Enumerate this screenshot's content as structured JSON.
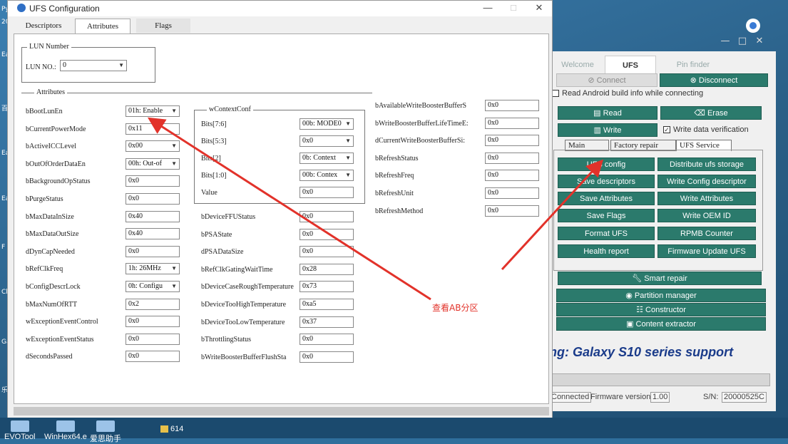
{
  "desktop": {
    "left_icons": [
      "Py",
      "20",
      "Ea",
      "百",
      "Ea",
      "Ea",
      "F",
      "Cl",
      "Ga",
      "乐"
    ]
  },
  "taskbar": {
    "items": [
      "EVOTool",
      "WinHex64.e",
      "爱思助手"
    ],
    "folder": "614"
  },
  "right_app": {
    "tabs": [
      "Welcome",
      "UFS",
      "Pin finder"
    ],
    "connect": "Connect",
    "disconnect": "Disconnect",
    "read_android_info": "Read Android build info while connecting",
    "read": "Read",
    "erase": "Erase",
    "write": "Write",
    "write_verify": "Write data verification",
    "subtabs": [
      "Main",
      "Factory repair",
      "UFS Service"
    ],
    "service_buttons": [
      "UFS config",
      "Distribute ufs storage",
      "Save descriptors",
      "Write Config descriptor",
      "Save Attributes",
      "Write Attributes",
      "Save Flags",
      "Write OEM ID",
      "Format UFS",
      "RPMB Counter",
      "Health report",
      "Firmware Update UFS"
    ],
    "smart_repair": "Smart repair",
    "partition_manager": "Partition manager",
    "constructor": "Constructor",
    "content_extractor": "Content extractor",
    "marquee": "ng: Galaxy S10 series support",
    "status": {
      "connected": "Connected",
      "fw_label": "Firmware version:",
      "fw_value": "1.00",
      "sn_label": "S/N:",
      "sn_value": "20000525C"
    }
  },
  "ufs_window": {
    "title": "UFS Configuration",
    "tabs": [
      "Descriptors",
      "Attributes",
      "Flags"
    ],
    "lun_group": "LUN Number",
    "lun_label": "LUN NO.:",
    "lun_value": "0",
    "attr_group": "Attributes",
    "col1": [
      {
        "label": "bBootLunEn",
        "value": "01h: Enable",
        "combo": true
      },
      {
        "label": "bCurrentPowerMode",
        "value": "0x11",
        "combo": false
      },
      {
        "label": "bActiveICCLevel",
        "value": "0x00",
        "combo": true
      },
      {
        "label": "bOutOfOrderDataEn",
        "value": "00h: Out-of",
        "combo": true
      },
      {
        "label": "bBackgroundOpStatus",
        "value": "0x0",
        "combo": false
      },
      {
        "label": "bPurgeStatus",
        "value": "0x0",
        "combo": false
      },
      {
        "label": "bMaxDataInSize",
        "value": "0x40",
        "combo": false
      },
      {
        "label": "bMaxDataOutSize",
        "value": "0x40",
        "combo": false
      },
      {
        "label": "dDynCapNeeded",
        "value": "0x0",
        "combo": false
      },
      {
        "label": "bRefClkFreq",
        "value": "1h: 26MHz",
        "combo": true
      },
      {
        "label": "bConfigDescrLock",
        "value": "0h: Configu",
        "combo": true
      },
      {
        "label": "bMaxNumOfRTT",
        "value": "0x2",
        "combo": false
      },
      {
        "label": "wExceptionEventControl",
        "value": "0x0",
        "combo": false
      },
      {
        "label": "wExceptionEventStatus",
        "value": "0x0",
        "combo": false
      },
      {
        "label": "dSecondsPassed",
        "value": "0x0",
        "combo": false
      }
    ],
    "wctx_group": "wContextConf",
    "wctx": [
      {
        "label": "Bits[7:6]",
        "value": "00b: MODE0",
        "combo": true
      },
      {
        "label": "Bits[5:3]",
        "value": "0x0",
        "combo": true
      },
      {
        "label": "Bits[2]",
        "value": "0b: Context",
        "combo": true
      },
      {
        "label": "Bits[1:0]",
        "value": "00b: Contex",
        "combo": true
      },
      {
        "label": "Value",
        "value": "0x0",
        "combo": false
      }
    ],
    "col2": [
      {
        "label": "bDeviceFFUStatus",
        "value": "0x0"
      },
      {
        "label": "bPSAState",
        "value": "0x0"
      },
      {
        "label": "dPSADataSize",
        "value": "0x0"
      },
      {
        "label": "bRefClkGatingWaitTime",
        "value": "0x28"
      },
      {
        "label": "bDeviceCaseRoughTemperature",
        "value": "0x73"
      },
      {
        "label": "bDeviceTooHighTemperature",
        "value": "0xa5"
      },
      {
        "label": "bDeviceTooLowTemperature",
        "value": "0x37"
      },
      {
        "label": "bThrottlingStatus",
        "value": "0x0"
      },
      {
        "label": "bWriteBoosterBufferFlushSta",
        "value": "0x0"
      }
    ],
    "col3": [
      {
        "label": "bAvailableWriteBoosterBufferS",
        "value": "0x0"
      },
      {
        "label": "bWriteBoosterBufferLifeTimeE:",
        "value": "0x0"
      },
      {
        "label": "dCurrentWriteBoosterBufferSi:",
        "value": "0x0"
      },
      {
        "label": "bRefreshStatus",
        "value": "0x0"
      },
      {
        "label": "bRefreshFreq",
        "value": "0x0"
      },
      {
        "label": "bRefreshUnit",
        "value": "0x0"
      },
      {
        "label": "bRefreshMethod",
        "value": "0x0"
      }
    ]
  },
  "annotation": "查看AB分区",
  "colors": {
    "button": "#2b7a6c",
    "arrow": "#e2322a"
  }
}
